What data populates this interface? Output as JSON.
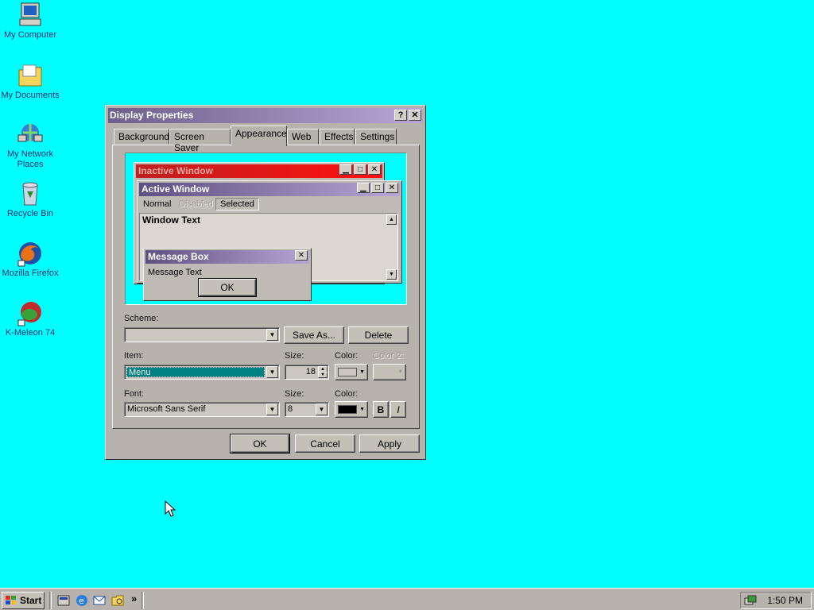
{
  "desktop": {
    "icons": [
      {
        "label": "My Computer",
        "icon": "computer-icon"
      },
      {
        "label": "My Documents",
        "icon": "folder-icon"
      },
      {
        "label": "My Network Places",
        "icon": "network-icon"
      },
      {
        "label": "Recycle Bin",
        "icon": "recycle-bin-icon"
      },
      {
        "label": "Mozilla Firefox",
        "icon": "firefox-icon"
      },
      {
        "label": "K-Meleon 74",
        "icon": "k-meleon-icon"
      }
    ]
  },
  "dialog": {
    "title": "Display Properties",
    "help_glyph": "?",
    "close_glyph": "✕",
    "tabs": [
      "Background",
      "Screen Saver",
      "Appearance",
      "Web",
      "Effects",
      "Settings"
    ],
    "active_tab": "Appearance",
    "preview": {
      "inactive_title": "Inactive Window",
      "active_title": "Active Window",
      "menu": [
        "Normal",
        "Disabled",
        "Selected"
      ],
      "window_text": "Window Text",
      "msgbox_title": "Message Box",
      "msgbox_text": "Message Text",
      "msgbox_ok": "OK"
    },
    "scheme_label": "Scheme:",
    "scheme_value": "",
    "save_as": "Save As...",
    "delete": "Delete",
    "item_label": "Item:",
    "item_value": "Menu",
    "item_size_label": "Size:",
    "item_size_value": "18",
    "item_color_label": "Color:",
    "item_color2_label": "Color 2:",
    "font_label": "Font:",
    "font_value": "Microsoft Sans Serif",
    "font_size_label": "Size:",
    "font_size_value": "8",
    "font_color_label": "Color:",
    "bold": "B",
    "italic": "I",
    "ok": "OK",
    "cancel": "Cancel",
    "apply": "Apply"
  },
  "taskbar": {
    "start": "Start",
    "quick_launch_more": "»",
    "clock": "1:50 PM"
  },
  "colors": {
    "desktop": "#00ffff",
    "active_title": "#6e5f8c",
    "inactive_title": "#ff0000",
    "selection": "#008080"
  }
}
